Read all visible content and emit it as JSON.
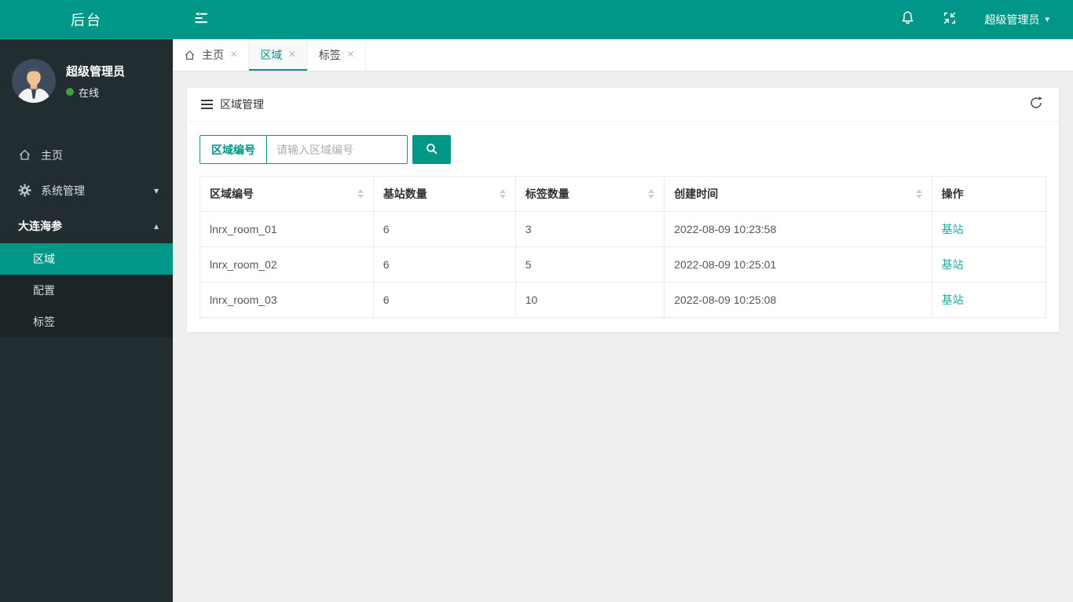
{
  "topbar": {
    "logo": "后台",
    "username": "超级管理员"
  },
  "icons": {
    "close": "×",
    "caret_down": "▾",
    "caret_up": "▴"
  },
  "sidebar": {
    "user": {
      "name": "超级管理员",
      "status": "在线"
    },
    "items": [
      {
        "label": "主页"
      },
      {
        "label": "系统管理"
      },
      {
        "label": "大连海参"
      }
    ],
    "submenu": [
      {
        "label": "区域"
      },
      {
        "label": "配置"
      },
      {
        "label": "标签"
      }
    ]
  },
  "tabs": [
    {
      "label": "主页"
    },
    {
      "label": "区域"
    },
    {
      "label": "标签"
    }
  ],
  "panel": {
    "title": "区域管理",
    "search": {
      "label": "区域编号",
      "placeholder": "请输入区域编号"
    },
    "table": {
      "columns": [
        {
          "label": "区域编号"
        },
        {
          "label": "基站数量"
        },
        {
          "label": "标签数量"
        },
        {
          "label": "创建时间"
        },
        {
          "label": "操作"
        }
      ],
      "rows": [
        {
          "region": "lnrx_room_01",
          "stations": "6",
          "tags": "3",
          "created": "2022-08-09 10:23:58",
          "action": "基站"
        },
        {
          "region": "lnrx_room_02",
          "stations": "6",
          "tags": "5",
          "created": "2022-08-09 10:25:01",
          "action": "基站"
        },
        {
          "region": "lnrx_room_03",
          "stations": "6",
          "tags": "10",
          "created": "2022-08-09 10:25:08",
          "action": "基站"
        }
      ]
    }
  },
  "colors": {
    "accent": "#009688",
    "sidebar": "#222d32",
    "submenu_bg": "#1c2428",
    "link": "#1fa99e",
    "online": "#43a047"
  }
}
